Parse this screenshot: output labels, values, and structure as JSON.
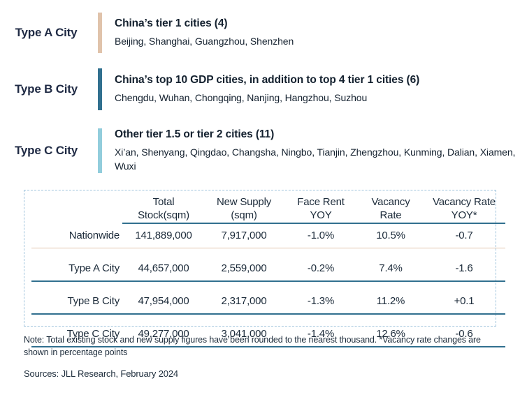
{
  "city_types": [
    {
      "label": "Type A City",
      "accent_color": "#e0c3ab",
      "heading": "China’s tier 1 cities (4)",
      "cities": "Beijing,  Shanghai,  Guangzhou,  Shenzhen"
    },
    {
      "label": "Type B City",
      "accent_color": "#31708f",
      "heading": "China’s top 10 GDP cities, in addition to top 4 tier 1 cities (6)",
      "cities": "Chengdu,  Wuhan,  Chongqing,  Nanjing,  Hangzhou,  Suzhou"
    },
    {
      "label": "Type C City",
      "accent_color": "#92cddc",
      "heading": "Other tier 1.5 or tier 2 cities (11)",
      "cities": "Xi’an, Shenyang,  Qingdao, Changsha,  Ningbo, Tianjin, Zhengzhou, Kunming,  Dalian, Xiamen, Wuxi"
    }
  ],
  "table": {
    "columns": [
      {
        "line1": "",
        "line2": ""
      },
      {
        "line1": "Total",
        "line2": "Stock(sqm)"
      },
      {
        "line1": "New Supply",
        "line2": "(sqm)"
      },
      {
        "line1": "Face Rent",
        "line2": "YOY"
      },
      {
        "line1": "Vacancy",
        "line2": "Rate"
      },
      {
        "line1": "Vacancy Rate",
        "line2": "YOY*"
      }
    ],
    "rows": [
      {
        "label": "Nationwide",
        "total_stock": "141,889,000",
        "new_supply": "7,917,000",
        "face_rent_yoy": "-1.0%",
        "vacancy_rate": "10.5%",
        "vacancy_rate_yoy": "-0.7"
      },
      {
        "label": "Type A City",
        "total_stock": "44,657,000",
        "new_supply": "2,559,000",
        "face_rent_yoy": "-0.2%",
        "vacancy_rate": "7.4%",
        "vacancy_rate_yoy": "-1.6"
      },
      {
        "label": "Type B City",
        "total_stock": "47,954,000",
        "new_supply": "2,317,000",
        "face_rent_yoy": "-1.3%",
        "vacancy_rate": "11.2%",
        "vacancy_rate_yoy": "+0.1"
      },
      {
        "label": "Type C City",
        "total_stock": "49,277,000",
        "new_supply": "3,041,000",
        "face_rent_yoy": "-1.4%",
        "vacancy_rate": "12.6%",
        "vacancy_rate_yoy": "-0.6"
      }
    ]
  },
  "footnotes": {
    "note": "Note: Total existing stock and new supply figures have been rounded to the nearest thousand. *Vacancy rate changes are shown in percentage points",
    "sources": "Sources: JLL Research,  February 2024"
  },
  "colors": {
    "rule_primary": "#31708f",
    "rule_tan": "#e0c3ab",
    "table_border": "#9fc3dc",
    "text": "#1c2b3a"
  }
}
